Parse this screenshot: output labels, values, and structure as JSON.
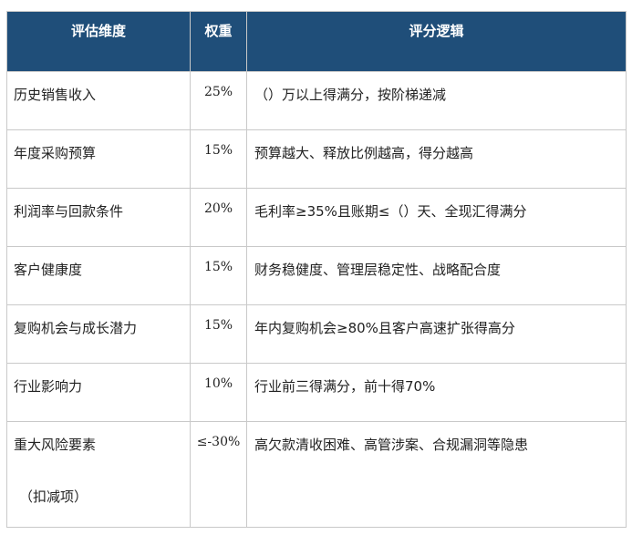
{
  "headers": {
    "dimension": "评估维度",
    "weight": "权重",
    "logic": "评分逻辑"
  },
  "rows": [
    {
      "dimension": "历史销售收入",
      "weight": "25%",
      "logic": "（）万以上得满分，按阶梯递减"
    },
    {
      "dimension": "年度采购预算",
      "weight": "15%",
      "logic": "预算越大、释放比例越高，得分越高"
    },
    {
      "dimension": "利润率与回款条件",
      "weight": "20%",
      "logic": "毛利率≥35%且账期≤（）天、全现汇得满分"
    },
    {
      "dimension": "客户健康度",
      "weight": "15%",
      "logic": "财务稳健度、管理层稳定性、战略配合度"
    },
    {
      "dimension": "复购机会与成长潜力",
      "weight": "15%",
      "logic": "年内复购机会≥80%且客户高速扩张得高分"
    },
    {
      "dimension": "行业影响力",
      "weight": "10%",
      "logic": "行业前三得满分，前十得70%"
    },
    {
      "dimension": "重大风险要素",
      "dimension_note": "（扣减项）",
      "weight": "≤-30%",
      "logic": "高欠款清收困难、高管涉案、合规漏洞等隐患"
    }
  ],
  "colors": {
    "header_bg": "#1f4e79",
    "header_text": "#ffffff",
    "border": "#c9c9c9"
  }
}
